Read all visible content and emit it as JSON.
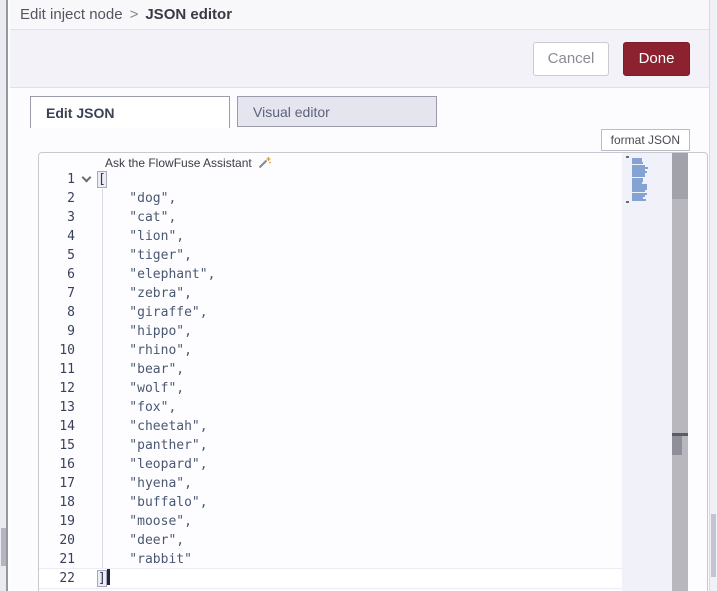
{
  "breadcrumb": {
    "parent_label": "Edit inject node",
    "separator": ">",
    "current_label": "JSON editor"
  },
  "actions": {
    "cancel_label": "Cancel",
    "done_label": "Done"
  },
  "tabs": {
    "edit_json_label": "Edit JSON",
    "visual_editor_label": "Visual editor",
    "active_tab": "Edit JSON"
  },
  "editor_toolbar": {
    "format_json_label": "format JSON"
  },
  "assistant": {
    "label": "Ask the FlowFuse Assistant",
    "icon": "magic-wand-icon"
  },
  "editor": {
    "language": "json",
    "total_lines": 22,
    "open_bracket": "[",
    "close_bracket": "]",
    "array_values": [
      "dog",
      "cat",
      "lion",
      "tiger",
      "elephant",
      "zebra",
      "giraffe",
      "hippo",
      "rhino",
      "bear",
      "wolf",
      "fox",
      "cheetah",
      "panther",
      "leopard",
      "hyena",
      "buffalo",
      "moose",
      "deer",
      "rabbit"
    ],
    "cursor": {
      "line": 22,
      "position": "after-close-bracket"
    },
    "folded_chevron_line": 1
  },
  "colors": {
    "done_button": "#8c2130",
    "string_text": "#4b5872",
    "minimap_mark": "#84a3d2",
    "inactive_tab_bg": "#e5e5f0"
  }
}
